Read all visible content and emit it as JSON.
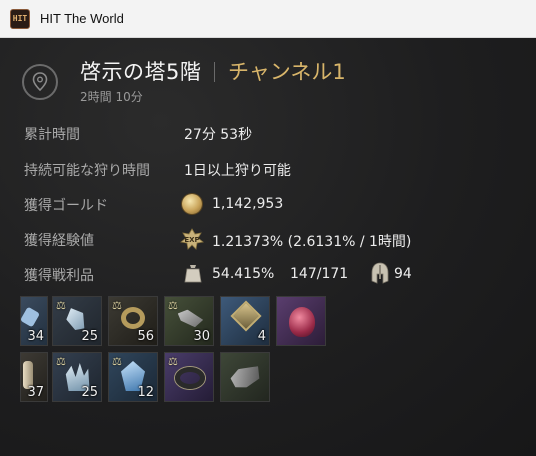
{
  "window": {
    "title": "HIT The World",
    "icon_text": "HIT"
  },
  "header": {
    "location": "啓示の塔5階",
    "channel": "チャンネル1",
    "duration": "2時間 10分"
  },
  "stats": [
    {
      "label": "累計時間",
      "value": "27分 53秒"
    },
    {
      "label": "持続可能な狩り時間",
      "value": "1日以上狩り可能"
    },
    {
      "label": "獲得ゴールド",
      "value": "1,142,953",
      "icon": "gold-coin-icon"
    },
    {
      "label": "獲得経験値",
      "value": "1.21373% (2.6131% / 1時間)",
      "icon": "exp-icon"
    },
    {
      "label": "獲得戦利品",
      "value": "54.415%",
      "slots": "147/171",
      "equip_count": "94",
      "icon": "bag-icon"
    }
  ],
  "loot": {
    "row1": [
      {
        "name": "blue-crystal-item",
        "count": "34",
        "scale": true
      },
      {
        "name": "crystal-shard-item",
        "count": "25",
        "scale": true
      },
      {
        "name": "gold-ring-item",
        "count": "56",
        "scale": true
      },
      {
        "name": "green-material-item",
        "count": "30",
        "scale": true
      },
      {
        "name": "blue-gem-item",
        "count": "4",
        "scale": false
      },
      {
        "name": "red-gem-item",
        "count": "",
        "scale": false
      }
    ],
    "row2": [
      {
        "name": "bone-item",
        "count": "37",
        "scale": true
      },
      {
        "name": "crystal-cluster-item",
        "count": "25",
        "scale": true
      },
      {
        "name": "blue-ore-item",
        "count": "12",
        "scale": true
      },
      {
        "name": "dark-ring-item",
        "count": "",
        "scale": true
      },
      {
        "name": "gray-material-item",
        "count": "",
        "scale": false
      }
    ],
    "scale_glyph": "⚖"
  },
  "colors": {
    "channel": "#d8b56a",
    "label": "#a9a9a9",
    "value": "#ececec"
  }
}
